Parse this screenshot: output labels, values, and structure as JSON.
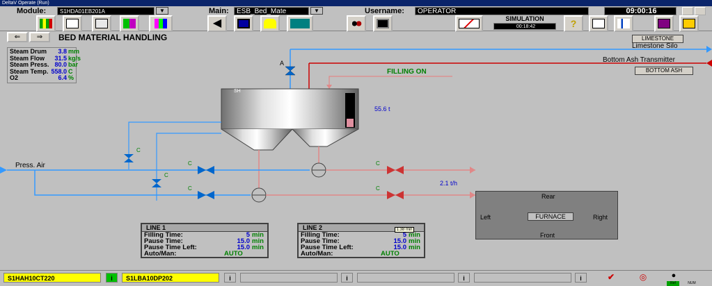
{
  "window": {
    "title": "DeltaV Operate (Run)"
  },
  "toolbar": {
    "module_label": "Module:",
    "module_value": "S1HDA01EB201A",
    "main_label": "Main:",
    "main_value": "ESB_Bed_Mate",
    "username_label": "Username:",
    "username_value": "OPERATOR",
    "time": "09:00:16",
    "simulation_label": "SIMULATION",
    "simulation_time": "00:18:42"
  },
  "page": {
    "title": "BED MATERIAL HANDLING"
  },
  "steam_info": [
    {
      "label": "Steam Drum",
      "value": "3.8",
      "unit": "mm"
    },
    {
      "label": "Steam Flow",
      "value": "31.5",
      "unit": "kg/s"
    },
    {
      "label": "Steam Press.",
      "value": "80.0",
      "unit": "bar"
    },
    {
      "label": "Steam Temp.",
      "value": "558.0",
      "unit": "C"
    },
    {
      "label": "O2",
      "value": "6.4",
      "unit": "%"
    }
  ],
  "process": {
    "filling_status": "FILLING ON",
    "silo_level": "55.6 t",
    "furnace_flow": "2.1 t/h",
    "press_air": "Press. Air",
    "limestone_button": "LIMESTONE",
    "limestone_silo": "Limestone Silo",
    "bottom_ash_transmitter": "Bottom Ash Transmitter",
    "bottom_ash_button": "BOTTOM ASH",
    "valve_a": "A",
    "valve_c": "C",
    "silo_tag": "SH",
    "tooltip": "1.38 min"
  },
  "furnace": {
    "label": "FURNACE",
    "rear": "Rear",
    "front": "Front",
    "left": "Left",
    "right": "Right"
  },
  "line1": {
    "title": "LINE 1",
    "rows": [
      {
        "label": "Filling Time:",
        "value": "5",
        "unit": "min"
      },
      {
        "label": "Pause Time:",
        "value": "15.0",
        "unit": "min"
      },
      {
        "label": "Pause Time Left:",
        "value": "15.0",
        "unit": "min"
      }
    ],
    "mode_label": "Auto/Man:",
    "mode_value": "AUTO"
  },
  "line2": {
    "title": "LINE 2",
    "rows": [
      {
        "label": "Filling Time:",
        "value": "5",
        "unit": "min"
      },
      {
        "label": "Pause Time:",
        "value": "15.0",
        "unit": "min"
      },
      {
        "label": "Pause Time Left:",
        "value": "15.0",
        "unit": "min"
      }
    ],
    "mode_label": "Auto/Man:",
    "mode_value": "AUTO"
  },
  "statusbar": {
    "alarm1": "S1HAH10CT220",
    "alarm2": "S1LBA10DP202",
    "info_icon": "i",
    "indicator1": "Ref",
    "indicator2": "NUM"
  },
  "colors": {
    "air_line": "#3399ff",
    "ash_line": "#cc0000",
    "material_line": "#e08888",
    "valve_blue": "#0066cc",
    "valve_red": "#cc3333"
  }
}
